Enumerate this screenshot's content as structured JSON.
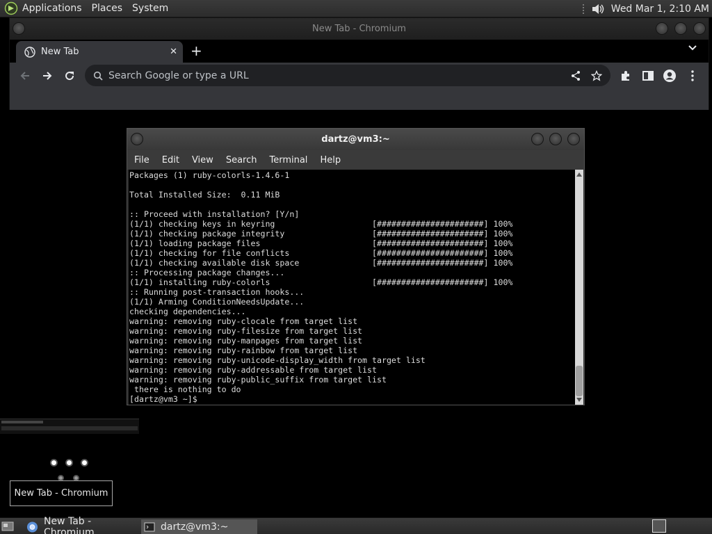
{
  "top_panel": {
    "menus": [
      "Applications",
      "Places",
      "System"
    ],
    "clock": "Wed Mar 1,  2:10 AM"
  },
  "chromium": {
    "window_title": "New Tab - Chromium",
    "tab_title": "New Tab",
    "omnibox_placeholder": "Search Google or type a URL"
  },
  "terminal": {
    "window_title": "dartz@vm3:~",
    "menus": [
      "File",
      "Edit",
      "View",
      "Search",
      "Terminal",
      "Help"
    ],
    "lines": [
      "Packages (1) ruby-colorls-1.4.6-1",
      "",
      "Total Installed Size:  0.11 MiB",
      "",
      ":: Proceed with installation? [Y/n]",
      "(1/1) checking keys in keyring                    [######################] 100%",
      "(1/1) checking package integrity                  [######################] 100%",
      "(1/1) loading package files                       [######################] 100%",
      "(1/1) checking for file conflicts                 [######################] 100%",
      "(1/1) checking available disk space               [######################] 100%",
      ":: Processing package changes...",
      "(1/1) installing ruby-colorls                     [######################] 100%",
      ":: Running post-transaction hooks...",
      "(1/1) Arming ConditionNeedsUpdate...",
      "checking dependencies...",
      "warning: removing ruby-clocale from target list",
      "warning: removing ruby-filesize from target list",
      "warning: removing ruby-manpages from target list",
      "warning: removing ruby-rainbow from target list",
      "warning: removing ruby-unicode-display_width from target list",
      "warning: removing ruby-addressable from target list",
      "warning: removing ruby-public_suffix from target list",
      " there is nothing to do",
      "[dartz@vm3 ~]$ "
    ]
  },
  "tooltip": "New Tab - Chromium",
  "taskbar": {
    "tasks": [
      {
        "label": "New Tab - Chromium",
        "icon": "chromium-icon"
      },
      {
        "label": "dartz@vm3:~",
        "icon": "terminal-icon"
      }
    ]
  }
}
